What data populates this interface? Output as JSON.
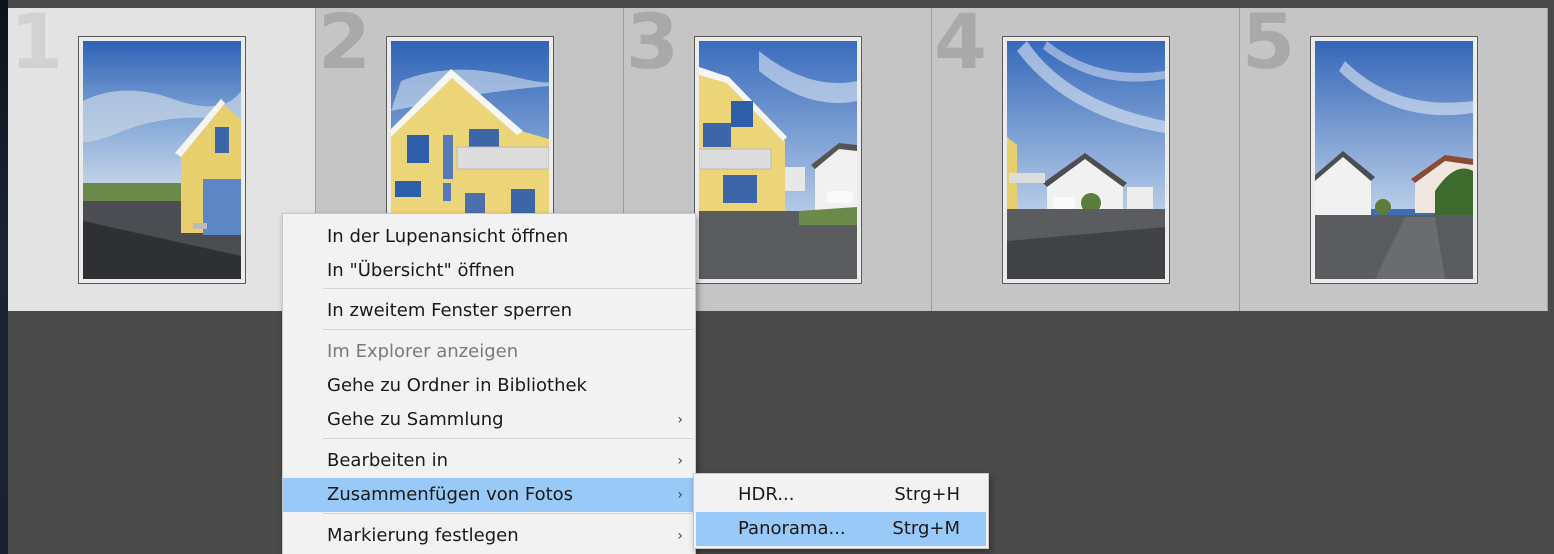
{
  "filmstrip": {
    "cells": [
      {
        "number": "1",
        "selected": true
      },
      {
        "number": "2",
        "selected": false
      },
      {
        "number": "3",
        "selected": false
      },
      {
        "number": "4",
        "selected": false
      },
      {
        "number": "5",
        "selected": false
      }
    ]
  },
  "context_menu": {
    "items": [
      {
        "label": "In der Lupenansicht öffnen",
        "disabled": false,
        "has_submenu": false
      },
      {
        "label": "In \"Übersicht\" öffnen",
        "disabled": false,
        "has_submenu": false
      },
      {
        "label": "In zweitem Fenster sperren",
        "disabled": false,
        "has_submenu": false
      },
      {
        "label": "Im Explorer anzeigen",
        "disabled": true,
        "has_submenu": false
      },
      {
        "label": "Gehe zu Ordner in Bibliothek",
        "disabled": false,
        "has_submenu": false
      },
      {
        "label": "Gehe zu Sammlung",
        "disabled": false,
        "has_submenu": true
      },
      {
        "label": "Bearbeiten in",
        "disabled": false,
        "has_submenu": true
      },
      {
        "label": "Zusammenfügen von Fotos",
        "disabled": false,
        "has_submenu": true,
        "highlighted": true
      },
      {
        "label": "Markierung festlegen",
        "disabled": false,
        "has_submenu": true
      }
    ],
    "arrow_glyph": "›"
  },
  "submenu": {
    "items": [
      {
        "label": "HDR...",
        "shortcut": "Strg+H",
        "highlighted": false
      },
      {
        "label": "Panorama...",
        "shortcut": "Strg+M",
        "highlighted": true
      }
    ]
  },
  "colors": {
    "menu_highlight": "#99c9f6",
    "panel_background": "#4a4a4a",
    "selected_cell": "#e3e3e3",
    "cell": "#c5c5c5"
  }
}
